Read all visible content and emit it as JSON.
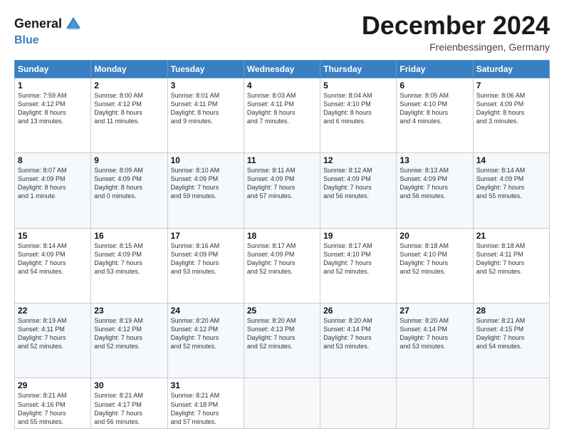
{
  "header": {
    "logo_line1": "General",
    "logo_line2": "Blue",
    "month": "December 2024",
    "location": "Freienbessingen, Germany"
  },
  "days_of_week": [
    "Sunday",
    "Monday",
    "Tuesday",
    "Wednesday",
    "Thursday",
    "Friday",
    "Saturday"
  ],
  "weeks": [
    [
      {
        "day": "1",
        "info": "Sunrise: 7:59 AM\nSunset: 4:12 PM\nDaylight: 8 hours\nand 13 minutes."
      },
      {
        "day": "2",
        "info": "Sunrise: 8:00 AM\nSunset: 4:12 PM\nDaylight: 8 hours\nand 11 minutes."
      },
      {
        "day": "3",
        "info": "Sunrise: 8:01 AM\nSunset: 4:11 PM\nDaylight: 8 hours\nand 9 minutes."
      },
      {
        "day": "4",
        "info": "Sunrise: 8:03 AM\nSunset: 4:11 PM\nDaylight: 8 hours\nand 7 minutes."
      },
      {
        "day": "5",
        "info": "Sunrise: 8:04 AM\nSunset: 4:10 PM\nDaylight: 8 hours\nand 6 minutes."
      },
      {
        "day": "6",
        "info": "Sunrise: 8:05 AM\nSunset: 4:10 PM\nDaylight: 8 hours\nand 4 minutes."
      },
      {
        "day": "7",
        "info": "Sunrise: 8:06 AM\nSunset: 4:09 PM\nDaylight: 8 hours\nand 3 minutes."
      }
    ],
    [
      {
        "day": "8",
        "info": "Sunrise: 8:07 AM\nSunset: 4:09 PM\nDaylight: 8 hours\nand 1 minute."
      },
      {
        "day": "9",
        "info": "Sunrise: 8:09 AM\nSunset: 4:09 PM\nDaylight: 8 hours\nand 0 minutes."
      },
      {
        "day": "10",
        "info": "Sunrise: 8:10 AM\nSunset: 4:09 PM\nDaylight: 7 hours\nand 59 minutes."
      },
      {
        "day": "11",
        "info": "Sunrise: 8:11 AM\nSunset: 4:09 PM\nDaylight: 7 hours\nand 57 minutes."
      },
      {
        "day": "12",
        "info": "Sunrise: 8:12 AM\nSunset: 4:09 PM\nDaylight: 7 hours\nand 56 minutes."
      },
      {
        "day": "13",
        "info": "Sunrise: 8:13 AM\nSunset: 4:09 PM\nDaylight: 7 hours\nand 56 minutes."
      },
      {
        "day": "14",
        "info": "Sunrise: 8:14 AM\nSunset: 4:09 PM\nDaylight: 7 hours\nand 55 minutes."
      }
    ],
    [
      {
        "day": "15",
        "info": "Sunrise: 8:14 AM\nSunset: 4:09 PM\nDaylight: 7 hours\nand 54 minutes."
      },
      {
        "day": "16",
        "info": "Sunrise: 8:15 AM\nSunset: 4:09 PM\nDaylight: 7 hours\nand 53 minutes."
      },
      {
        "day": "17",
        "info": "Sunrise: 8:16 AM\nSunset: 4:09 PM\nDaylight: 7 hours\nand 53 minutes."
      },
      {
        "day": "18",
        "info": "Sunrise: 8:17 AM\nSunset: 4:09 PM\nDaylight: 7 hours\nand 52 minutes."
      },
      {
        "day": "19",
        "info": "Sunrise: 8:17 AM\nSunset: 4:10 PM\nDaylight: 7 hours\nand 52 minutes."
      },
      {
        "day": "20",
        "info": "Sunrise: 8:18 AM\nSunset: 4:10 PM\nDaylight: 7 hours\nand 52 minutes."
      },
      {
        "day": "21",
        "info": "Sunrise: 8:18 AM\nSunset: 4:11 PM\nDaylight: 7 hours\nand 52 minutes."
      }
    ],
    [
      {
        "day": "22",
        "info": "Sunrise: 8:19 AM\nSunset: 4:11 PM\nDaylight: 7 hours\nand 52 minutes."
      },
      {
        "day": "23",
        "info": "Sunrise: 8:19 AM\nSunset: 4:12 PM\nDaylight: 7 hours\nand 52 minutes."
      },
      {
        "day": "24",
        "info": "Sunrise: 8:20 AM\nSunset: 4:12 PM\nDaylight: 7 hours\nand 52 minutes."
      },
      {
        "day": "25",
        "info": "Sunrise: 8:20 AM\nSunset: 4:13 PM\nDaylight: 7 hours\nand 52 minutes."
      },
      {
        "day": "26",
        "info": "Sunrise: 8:20 AM\nSunset: 4:14 PM\nDaylight: 7 hours\nand 53 minutes."
      },
      {
        "day": "27",
        "info": "Sunrise: 8:20 AM\nSunset: 4:14 PM\nDaylight: 7 hours\nand 53 minutes."
      },
      {
        "day": "28",
        "info": "Sunrise: 8:21 AM\nSunset: 4:15 PM\nDaylight: 7 hours\nand 54 minutes."
      }
    ],
    [
      {
        "day": "29",
        "info": "Sunrise: 8:21 AM\nSunset: 4:16 PM\nDaylight: 7 hours\nand 55 minutes."
      },
      {
        "day": "30",
        "info": "Sunrise: 8:21 AM\nSunset: 4:17 PM\nDaylight: 7 hours\nand 56 minutes."
      },
      {
        "day": "31",
        "info": "Sunrise: 8:21 AM\nSunset: 4:18 PM\nDaylight: 7 hours\nand 57 minutes."
      },
      {
        "day": "",
        "info": ""
      },
      {
        "day": "",
        "info": ""
      },
      {
        "day": "",
        "info": ""
      },
      {
        "day": "",
        "info": ""
      }
    ]
  ]
}
